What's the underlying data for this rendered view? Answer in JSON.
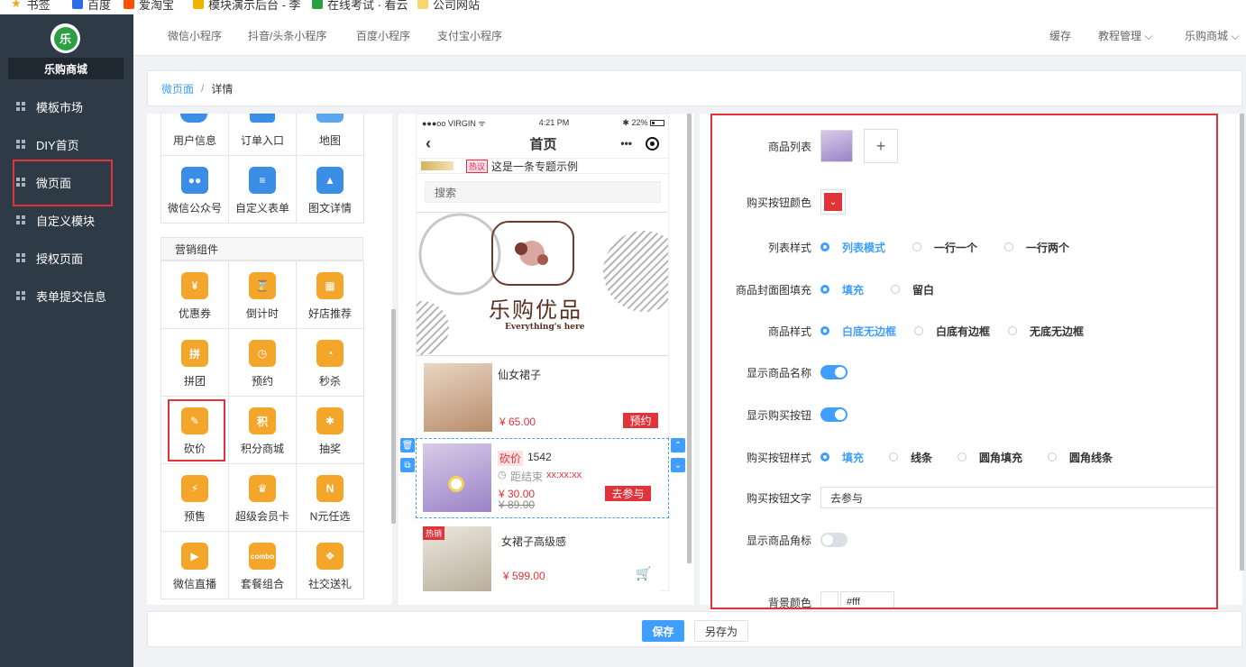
{
  "bookmarks": [
    {
      "label": "书签",
      "color": "#f5a623"
    },
    {
      "label": "百度",
      "color": "#2b6de5"
    },
    {
      "label": "爱淘宝",
      "color": "#ff5000"
    },
    {
      "label": "模块演示后台 - 李",
      "color": "#f0b400"
    },
    {
      "label": "在线考试 · 看云",
      "color": "#2aa043"
    },
    {
      "label": "公司网站",
      "color": "#f5d76e"
    }
  ],
  "sidebar": {
    "logo_text": "乐",
    "shop_name": "乐购商城",
    "items": [
      {
        "label": "模板市场"
      },
      {
        "label": "DIY首页"
      },
      {
        "label": "微页面"
      },
      {
        "label": "自定义模块"
      },
      {
        "label": "授权页面"
      },
      {
        "label": "表单提交信息"
      }
    ]
  },
  "topnav": {
    "tabs": [
      "微信小程序",
      "抖音/头条小程序",
      "百度小程序",
      "支付宝小程序"
    ],
    "right": [
      "缓存",
      "教程管理",
      "乐购商城"
    ]
  },
  "breadcrumb": {
    "link": "微页面",
    "sep": "/",
    "current": "详情"
  },
  "components": {
    "basic_top": [
      {
        "label": "用户信息",
        "color": "#3a8ee6"
      },
      {
        "label": "订单入口",
        "color": "#3a8ee6"
      },
      {
        "label": "地图",
        "color": "#3a8ee6"
      }
    ],
    "basic": [
      {
        "label": "微信公众号",
        "color": "#3a8ee6",
        "glyph": "●●"
      },
      {
        "label": "自定义表单",
        "color": "#3a8ee6",
        "glyph": "≡"
      },
      {
        "label": "图文详情",
        "color": "#3a8ee6",
        "glyph": "▲"
      }
    ],
    "marketing_title": "营销组件",
    "marketing": [
      {
        "label": "优惠券",
        "color": "#f4a62a",
        "glyph": "¥"
      },
      {
        "label": "倒计时",
        "color": "#f4a62a",
        "glyph": "⌛"
      },
      {
        "label": "好店推荐",
        "color": "#f4a62a",
        "glyph": "▦"
      },
      {
        "label": "拼团",
        "color": "#f4a62a",
        "glyph": "拼"
      },
      {
        "label": "预约",
        "color": "#f4a62a",
        "glyph": "◷"
      },
      {
        "label": "秒杀",
        "color": "#f4a62a",
        "glyph": "◔"
      },
      {
        "label": "砍价",
        "color": "#f4a62a",
        "glyph": "✎"
      },
      {
        "label": "积分商城",
        "color": "#f4a62a",
        "glyph": "积"
      },
      {
        "label": "抽奖",
        "color": "#f4a62a",
        "glyph": "✱"
      },
      {
        "label": "预售",
        "color": "#f4a62a",
        "glyph": "⚡"
      },
      {
        "label": "超级会员卡",
        "color": "#f4a62a",
        "glyph": "♛"
      },
      {
        "label": "N元任选",
        "color": "#f4a62a",
        "glyph": "N"
      },
      {
        "label": "微信直播",
        "color": "#f4a62a",
        "glyph": "▶"
      },
      {
        "label": "套餐组合",
        "color": "#f4a62a",
        "glyph": "combo"
      },
      {
        "label": "社交送礼",
        "color": "#f4a62a",
        "glyph": "❖"
      }
    ]
  },
  "phone": {
    "carrier": "●●●oo VIRGIN ᯤ",
    "time": "4:21 PM",
    "battery": "✱ 22%",
    "title": "首页",
    "notice_tag": "热议",
    "notice_text": "这是一条专题示例",
    "search": "搜索",
    "banner_title": "乐购优品",
    "banner_sub": "Everything's here",
    "products": [
      {
        "name": "仙女裙子",
        "price": "¥ 65.00",
        "btn": "预约",
        "color": "#d9b79a"
      },
      {
        "tag": "砍价",
        "name": "1542",
        "countdown_label": "距结束",
        "countdown": "xx:xx:xx",
        "price": "¥ 30.00",
        "old_price": "¥ 89.00",
        "btn": "去参与",
        "color": "#b8a0d8"
      },
      {
        "badge": "热销",
        "name": "女裙子高级感",
        "price": "¥ 599.00",
        "color": "#cfc7bb"
      }
    ]
  },
  "form": {
    "goods_label": "商品列表",
    "add": "+",
    "btn_color_label": "购买按钮颜色",
    "btn_color": "#e0333a",
    "list_style_label": "列表样式",
    "list_style": [
      "列表模式",
      "一行一个",
      "一行两个"
    ],
    "cover_label": "商品封面图填充",
    "cover": [
      "填充",
      "留白"
    ],
    "goods_style_label": "商品样式",
    "goods_style": [
      "白底无边框",
      "白底有边框",
      "无底无边框"
    ],
    "show_name_label": "显示商品名称",
    "show_btn_label": "显示购买按钮",
    "btn_style_label": "购买按钮样式",
    "btn_style": [
      "填充",
      "线条",
      "圆角填充",
      "圆角线条"
    ],
    "btn_text_label": "购买按钮文字",
    "btn_text": "去参与",
    "show_corner_label": "显示商品角标",
    "bg_label": "背景颜色",
    "bg_value": "#fff"
  },
  "footer": {
    "save": "保存",
    "save_as": "另存为"
  }
}
